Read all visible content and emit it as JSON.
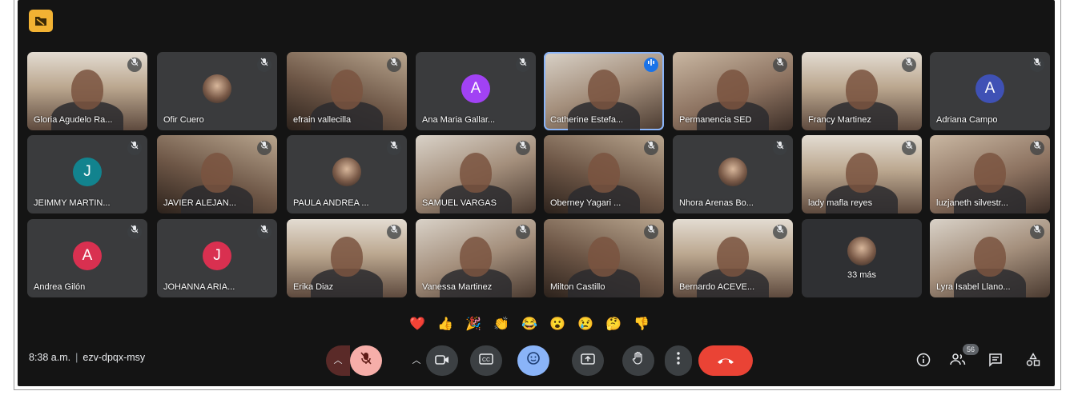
{
  "app": {
    "theme": "dark",
    "accent": "#8ab4f8",
    "end_call_color": "#ea4335"
  },
  "participants": [
    {
      "name": "Gloria Agudelo Ra...",
      "type": "video",
      "style": "v4"
    },
    {
      "name": "Ofir Cuero",
      "type": "photo-avatar"
    },
    {
      "name": "efrain vallecilla",
      "type": "video",
      "style": "v3"
    },
    {
      "name": "Ana Maria Gallar...",
      "type": "letter",
      "letter": "A",
      "color": "#a142f4"
    },
    {
      "name": "Catherine Estefa...",
      "type": "video",
      "style": "v2",
      "speaking": true
    },
    {
      "name": "Permanencia SED",
      "type": "video",
      "style": "v1"
    },
    {
      "name": "Francy Martinez",
      "type": "video",
      "style": "v4"
    },
    {
      "name": "Adriana Campo",
      "type": "letter",
      "letter": "A",
      "color": "#3f51b5"
    },
    {
      "name": "JEIMMY MARTIN...",
      "type": "letter",
      "letter": "J",
      "color": "#12838e"
    },
    {
      "name": "JAVIER ALEJAN...",
      "type": "video",
      "style": "v3"
    },
    {
      "name": "PAULA ANDREA ...",
      "type": "photo-avatar"
    },
    {
      "name": "SAMUEL VARGAS",
      "type": "video",
      "style": "v2"
    },
    {
      "name": "Oberney Yagari ...",
      "type": "video",
      "style": "v3"
    },
    {
      "name": "Nhora Arenas Bo...",
      "type": "photo-avatar"
    },
    {
      "name": "lady mafla reyes",
      "type": "video",
      "style": "v4"
    },
    {
      "name": "luzjaneth silvestr...",
      "type": "video",
      "style": "v1"
    },
    {
      "name": "Andrea Gilón",
      "type": "letter",
      "letter": "A",
      "color": "#d93050"
    },
    {
      "name": "JOHANNA ARIA...",
      "type": "letter",
      "letter": "J",
      "color": "#d93050"
    },
    {
      "name": "Erika Diaz",
      "type": "video",
      "style": "v4"
    },
    {
      "name": "Vanessa Martinez",
      "type": "video",
      "style": "v2"
    },
    {
      "name": "Milton Castillo",
      "type": "video",
      "style": "v3"
    },
    {
      "name": "Bernardo ACEVE...",
      "type": "video",
      "style": "v4"
    },
    {
      "name": "33 más",
      "type": "more"
    },
    {
      "name": "Lyra Isabel Llano...",
      "type": "video",
      "style": "v2"
    }
  ],
  "reactions": [
    "❤️",
    "👍",
    "🎉",
    "👏",
    "😂",
    "😮",
    "😢",
    "🤔",
    "👎"
  ],
  "meeting": {
    "time": "8:38 a.m.",
    "separator": "|",
    "code": "ezv-dpqx-msy"
  },
  "controls": {
    "mic_icon": "mic-off-icon",
    "camera_icon": "videocam-icon",
    "captions_icon": "cc-icon",
    "emoji_icon": "emoji-icon",
    "present_icon": "present-icon",
    "hand_icon": "hand-icon",
    "more_icon": "more-vert-icon",
    "end_icon": "call-end-icon"
  },
  "side": {
    "people_count": "56"
  }
}
